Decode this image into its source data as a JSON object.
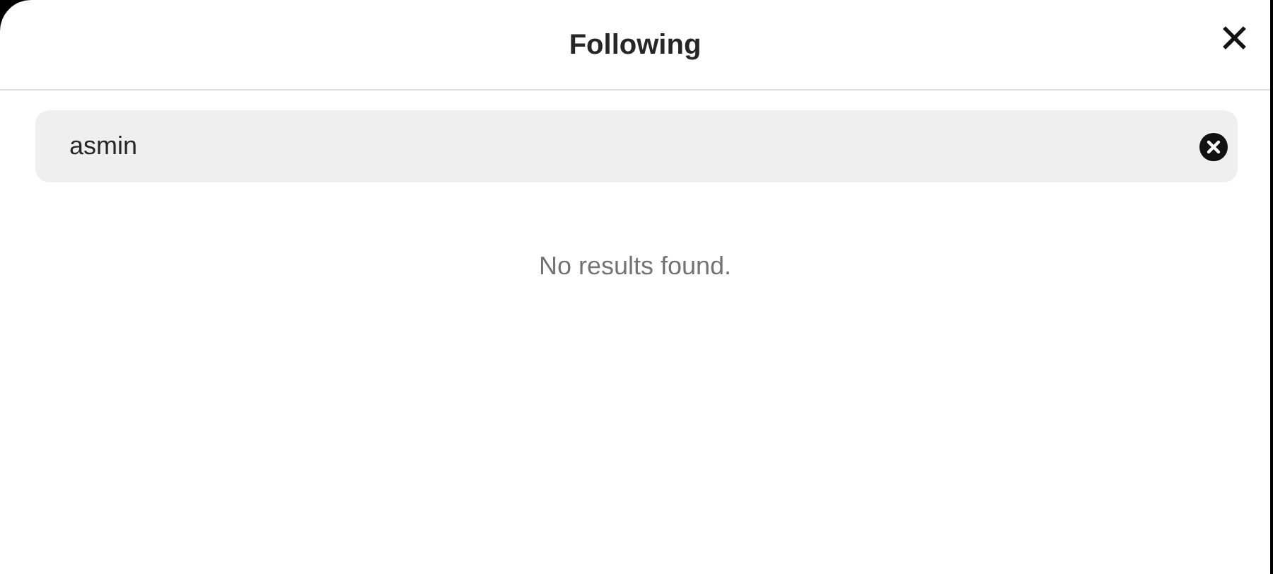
{
  "dialog": {
    "title": "Following",
    "close_label": "✕"
  },
  "search": {
    "value": "asmin"
  },
  "results": {
    "message": "No results found."
  }
}
